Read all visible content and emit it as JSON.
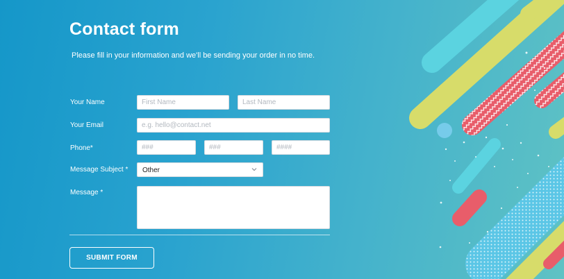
{
  "form": {
    "title": "Contact form",
    "subtitle": "Please fill in your information and we'll be sending your order in no time.",
    "name": {
      "label": "Your Name",
      "first_placeholder": "First Name",
      "last_placeholder": "Last Name"
    },
    "email": {
      "label": "Your Email",
      "placeholder": "e.g. hello@contact.net"
    },
    "phone": {
      "label": "Phone*",
      "part1_placeholder": "###",
      "part2_placeholder": "###",
      "part3_placeholder": "####"
    },
    "subject": {
      "label": "Message Subject *",
      "selected": "Other"
    },
    "message": {
      "label": "Message *",
      "value": ""
    },
    "submit_label": "SUBMIT FORM"
  },
  "colors": {
    "background_start": "#1597c9",
    "background_end": "#5fc2c4",
    "accent_red": "#e85d6a",
    "accent_yellow": "#d7dc6a",
    "accent_cyan": "#5bd3e0",
    "text": "#ffffff"
  },
  "icons": {
    "subject_dropdown": "chevron-down-icon"
  }
}
